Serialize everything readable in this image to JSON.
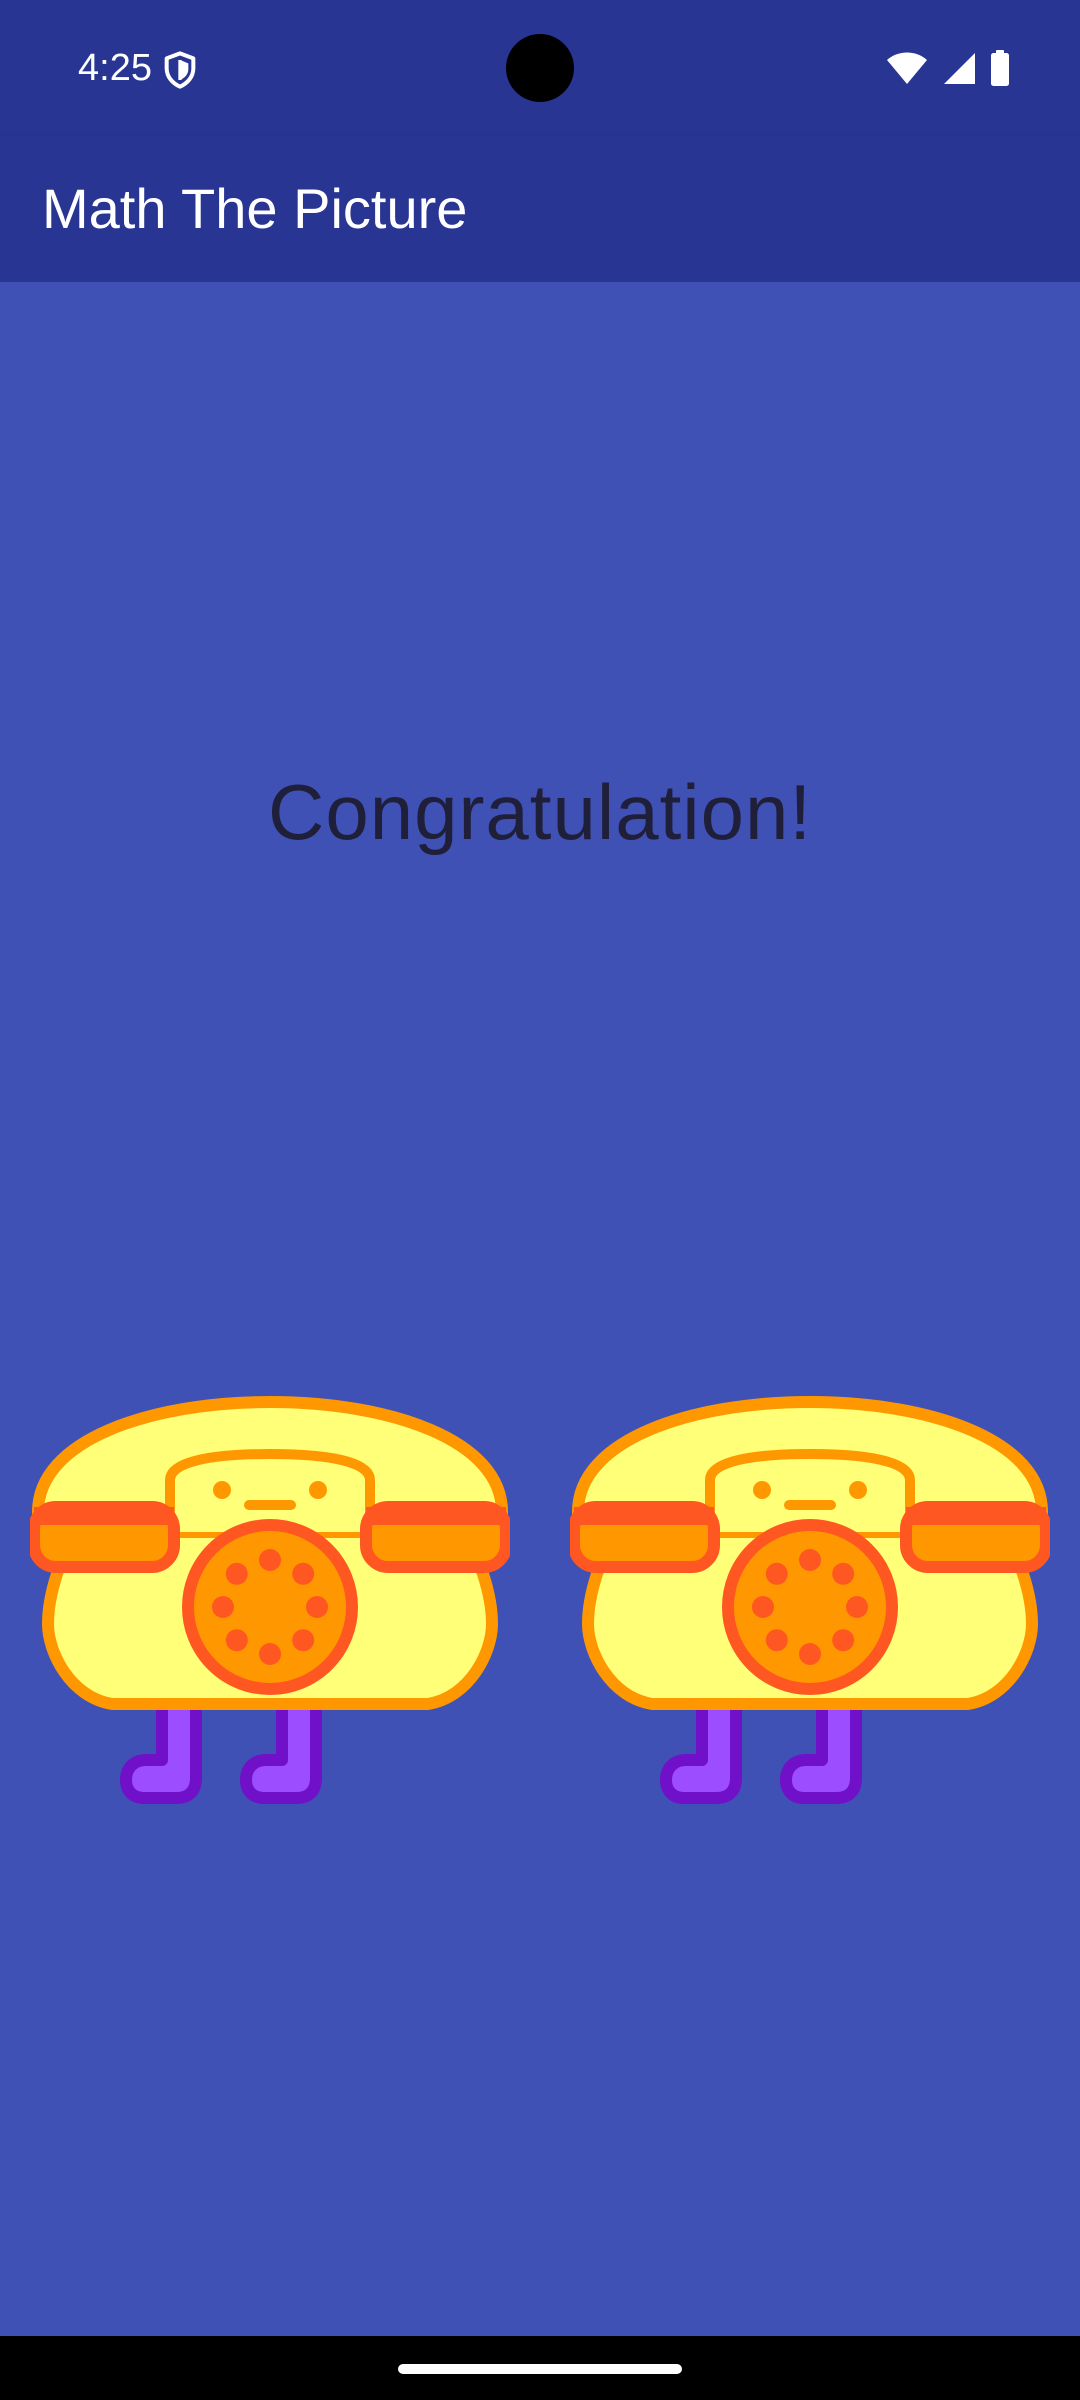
{
  "colors": {
    "status_bar_bg": "#283593",
    "app_bar_bg": "#283593",
    "content_bg": "#3f51b5",
    "nav_bar_bg": "#000000",
    "phone_body": "#ffff78",
    "phone_outline": "#ff9800",
    "phone_receiver_ends": "#ff9800",
    "phone_receiver_outline": "#ff5722",
    "dial_fill": "#ff9800",
    "dial_outline": "#ff5722",
    "dial_holes": "#ff5722",
    "boots_fill": "#9c4dff",
    "boots_outline": "#7010c8"
  },
  "status_bar": {
    "time": "4:25",
    "icons": [
      "shield-icon",
      "wifi-icon",
      "signal-icon",
      "battery-icon"
    ]
  },
  "app_bar": {
    "title": "Math The Picture"
  },
  "main": {
    "message": "Congratulation!",
    "pictures": [
      {
        "icon": "rotary-telephone-with-boots"
      },
      {
        "icon": "rotary-telephone-with-boots"
      }
    ]
  }
}
